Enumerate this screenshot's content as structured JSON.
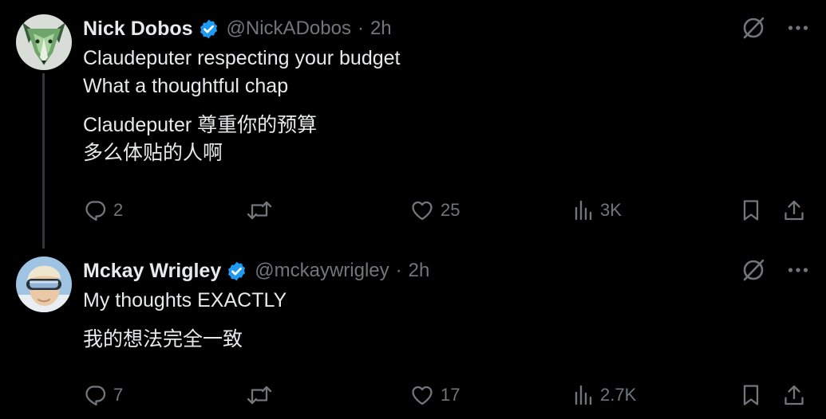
{
  "tweets": [
    {
      "name": "Nick Dobos",
      "handle": "@NickADobos",
      "separator": "·",
      "time": "2h",
      "body_lines": [
        "Claudeputer respecting your budget",
        "What a thoughtful chap"
      ],
      "translation_lines": [
        "Claudeputer 尊重你的预算",
        "多么体贴的人啊"
      ],
      "stats": {
        "replies": "2",
        "retweets": "",
        "likes": "25",
        "views": "3K"
      }
    },
    {
      "name": "Mckay Wrigley",
      "handle": "@mckaywrigley",
      "separator": "·",
      "time": "2h",
      "body_lines": [
        "My thoughts EXACTLY"
      ],
      "translation_lines": [
        "我的想法完全一致"
      ],
      "stats": {
        "replies": "7",
        "retweets": "",
        "likes": "17",
        "views": "2.7K"
      }
    }
  ],
  "colors": {
    "background": "#000000",
    "text": "#e7e9ea",
    "muted": "#71767b",
    "verified": "#1d9bf0",
    "thread_line": "#333639"
  },
  "icons": [
    "verified-badge-icon",
    "grok-icon",
    "more-icon",
    "reply-icon",
    "retweet-icon",
    "like-icon",
    "views-icon",
    "bookmark-icon",
    "share-icon"
  ]
}
